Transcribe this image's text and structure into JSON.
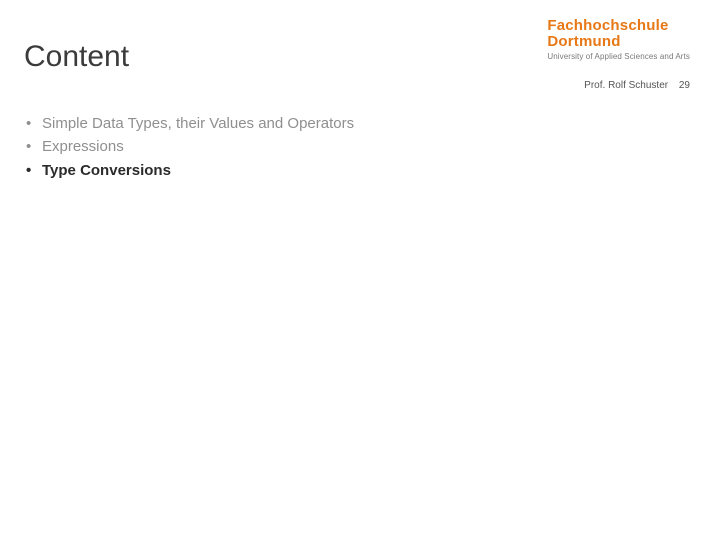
{
  "header": {
    "title": "Content"
  },
  "logo": {
    "line1": "Fachhochschule",
    "line2": "Dortmund",
    "sub": "University of Applied Sciences and Arts"
  },
  "meta": {
    "author": "Prof. Rolf Schuster",
    "page": "29"
  },
  "content": {
    "items": [
      {
        "label": "Simple Data Types, their Values and Operators",
        "active": false
      },
      {
        "label": "Expressions",
        "active": false
      },
      {
        "label": "Type Conversions",
        "active": true
      }
    ]
  }
}
